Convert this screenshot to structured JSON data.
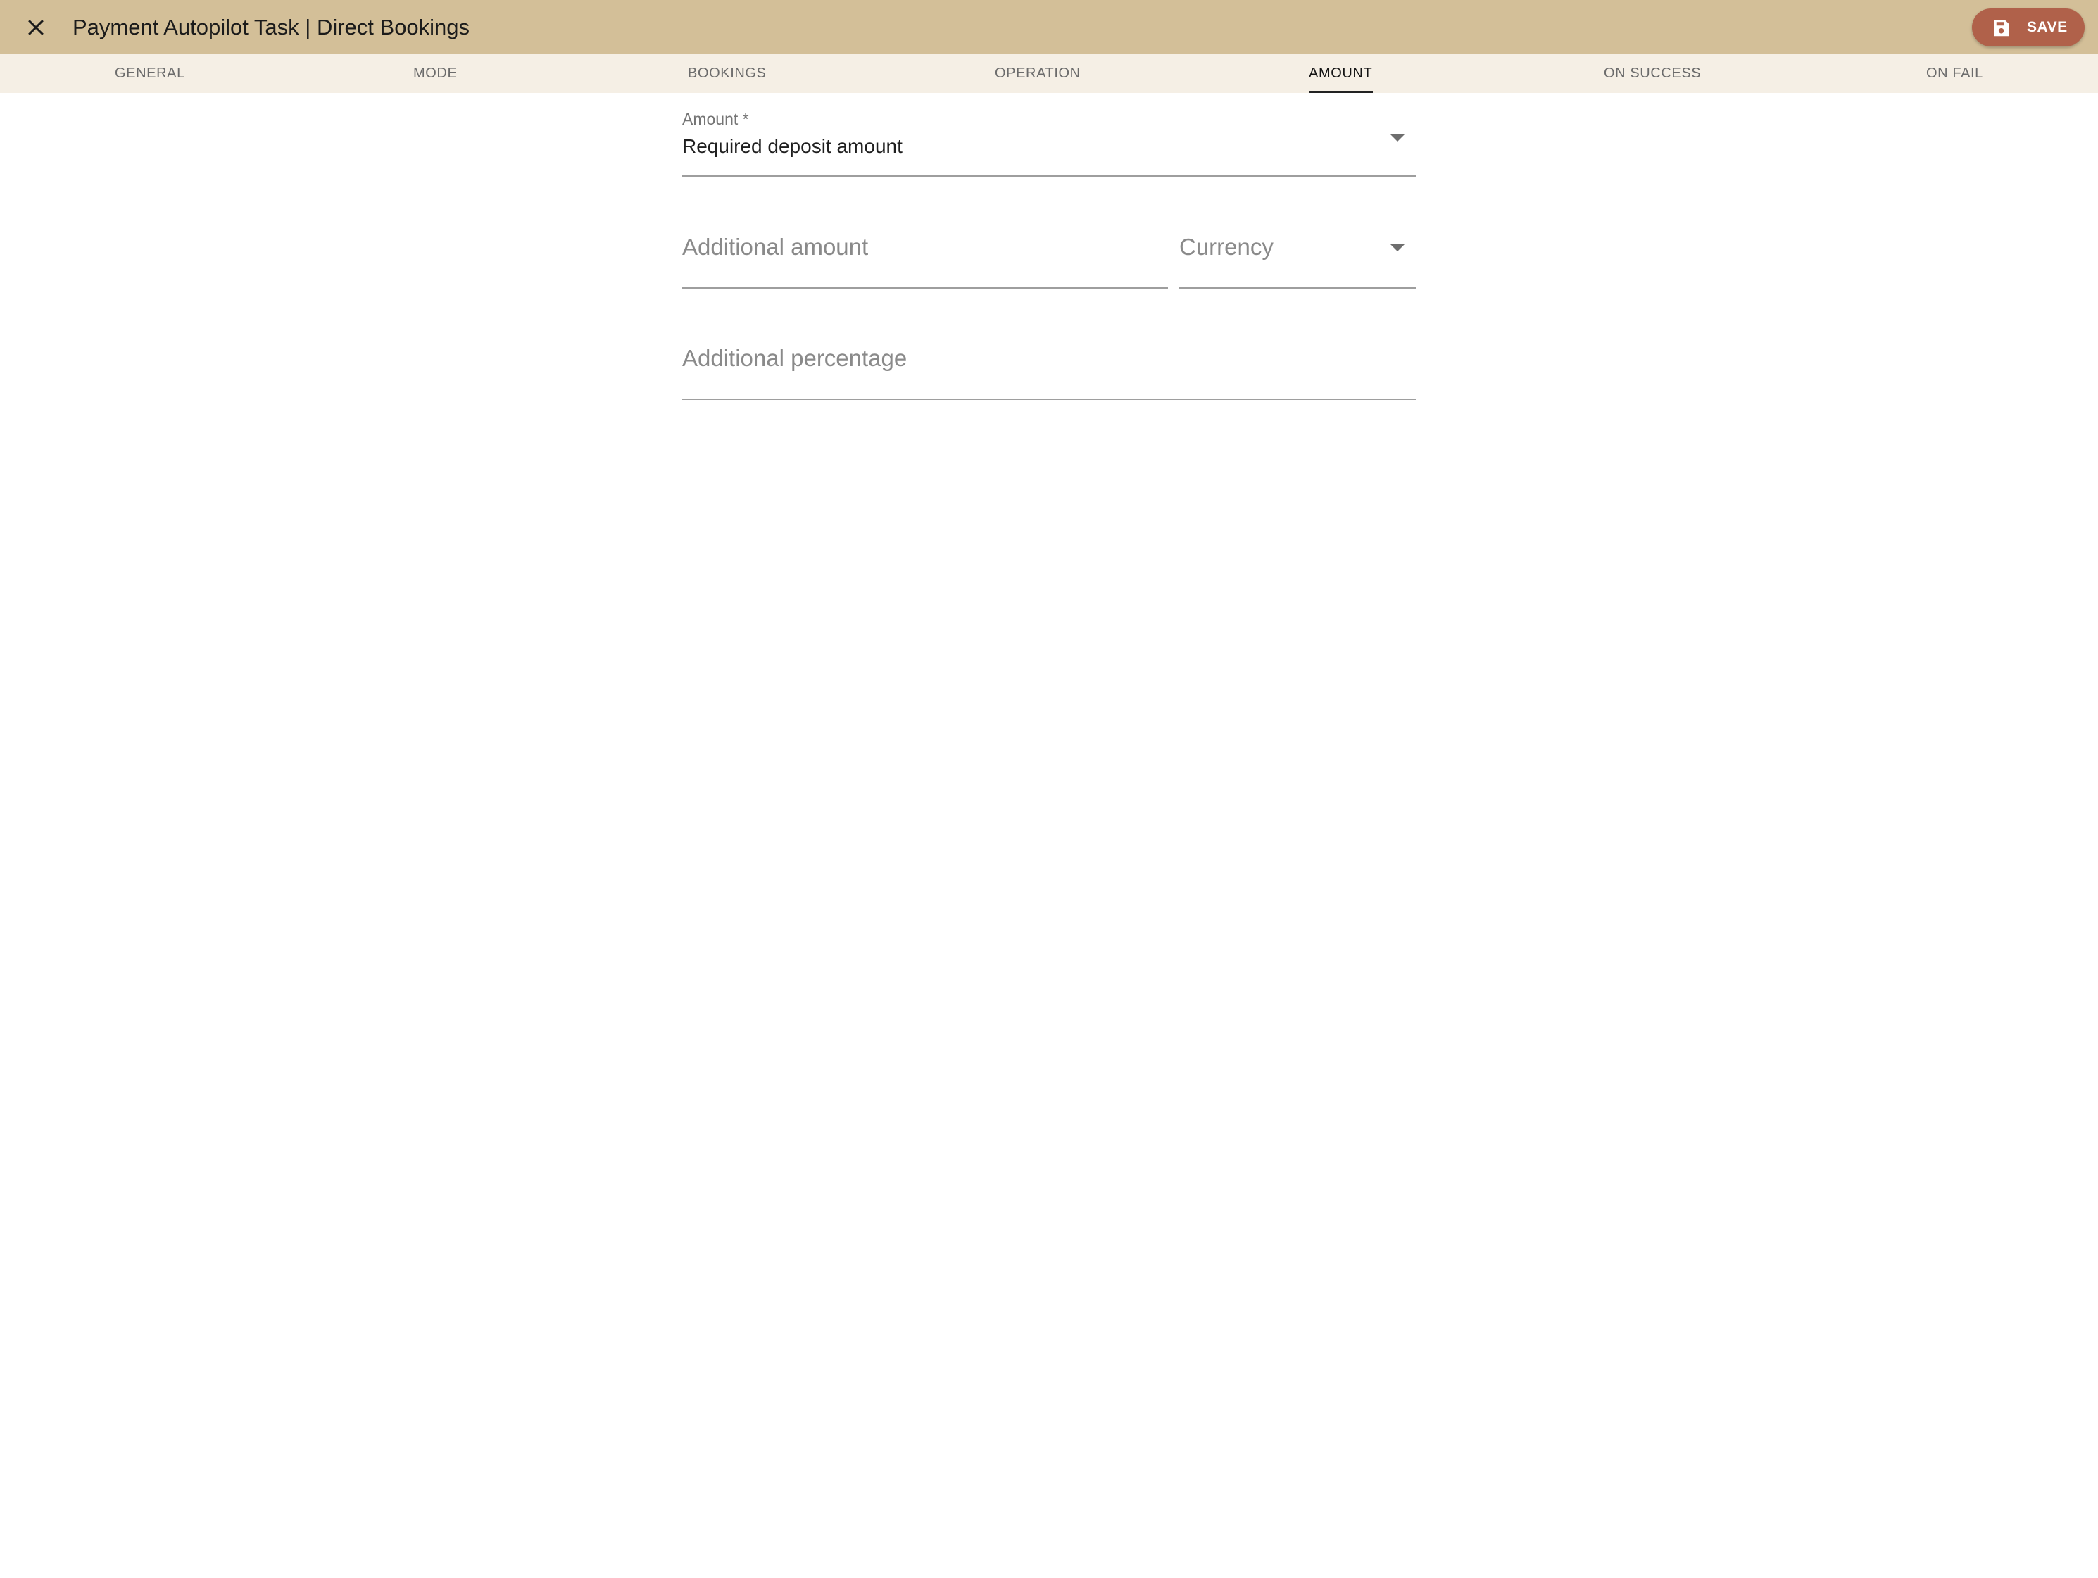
{
  "header": {
    "title": "Payment Autopilot Task | Direct Bookings",
    "close_icon": "close-icon",
    "save_label": "SAVE",
    "save_icon": "save-floppy-icon",
    "bar_color": "#d3bf98",
    "save_color": "#b0614a"
  },
  "tabs": [
    {
      "label": "GENERAL",
      "active": false
    },
    {
      "label": "MODE",
      "active": false
    },
    {
      "label": "BOOKINGS",
      "active": false
    },
    {
      "label": "OPERATION",
      "active": false
    },
    {
      "label": "AMOUNT",
      "active": true
    },
    {
      "label": "ON SUCCESS",
      "active": false
    },
    {
      "label": "ON FAIL",
      "active": false
    }
  ],
  "form": {
    "amount": {
      "label": "Amount *",
      "value": "Required deposit amount",
      "icon": "chevron-down-icon"
    },
    "additional_amount": {
      "placeholder": "Additional amount"
    },
    "currency": {
      "placeholder": "Currency",
      "icon": "chevron-down-icon"
    },
    "additional_percentage": {
      "placeholder": "Additional percentage"
    }
  }
}
